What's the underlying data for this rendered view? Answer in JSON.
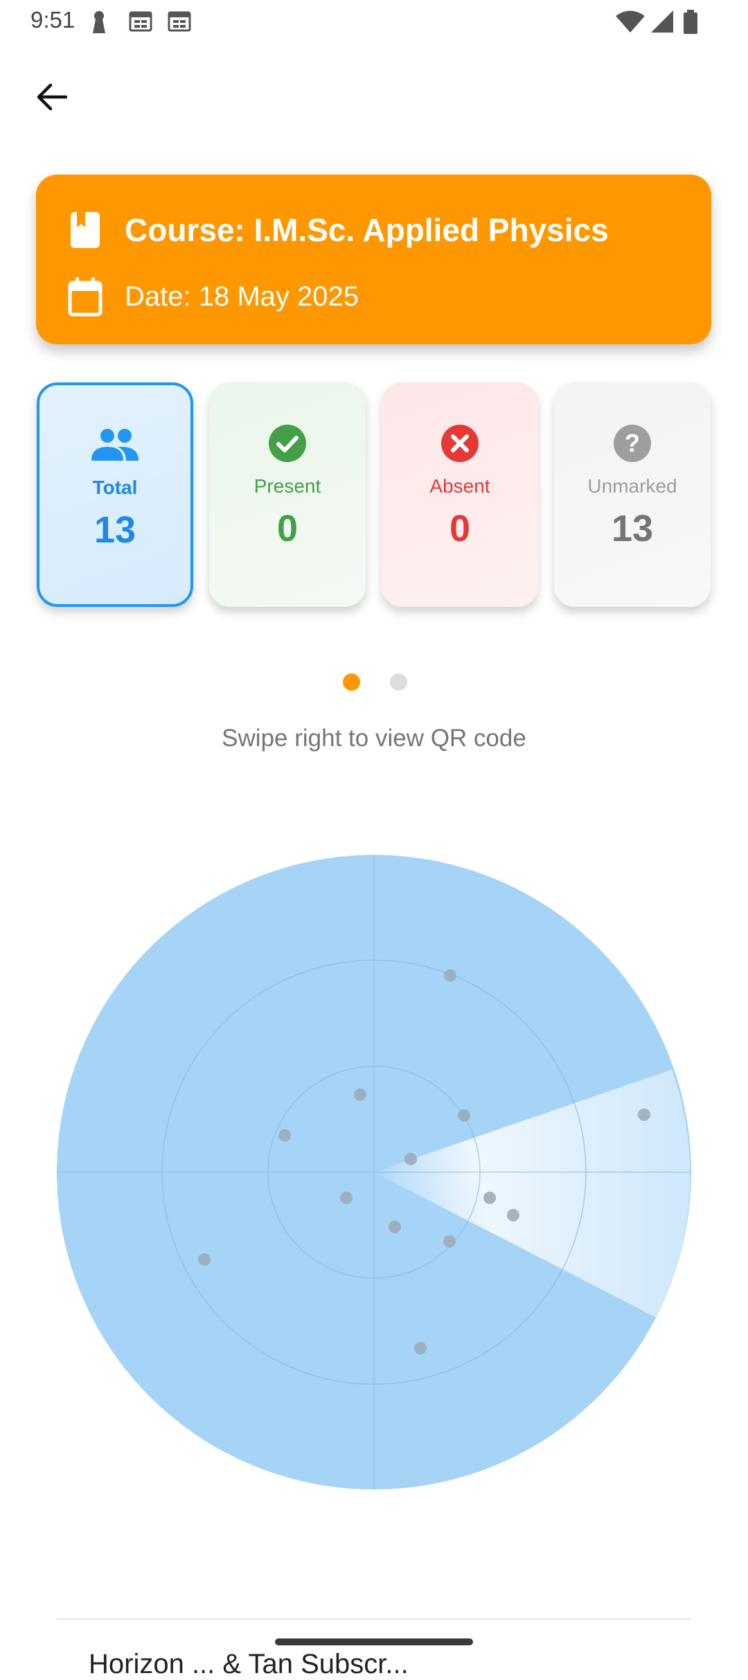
{
  "status_bar": {
    "time": "9:51",
    "icons_left": [
      "keyhole-icon",
      "calendar-notification-icon",
      "calendar-notification-icon"
    ],
    "icons_right": [
      "wifi-icon",
      "cellular-signal-icon",
      "battery-icon"
    ]
  },
  "app_bar": {
    "back_icon": "arrow-back-icon"
  },
  "course_card": {
    "accent_color": "#FF9800",
    "course_icon": "book-icon",
    "course_text": "Course: I.M.Sc. Applied Physics",
    "date_icon": "calendar-icon",
    "date_text": "Date: 18 May 2025"
  },
  "stats": [
    {
      "key": "total",
      "icon": "people-icon",
      "label": "Total",
      "value": "13",
      "color": "#2196F3",
      "selected": true
    },
    {
      "key": "present",
      "icon": "check-circle-icon",
      "label": "Present",
      "value": "0",
      "color": "#43A047"
    },
    {
      "key": "absent",
      "icon": "cancel-circle-icon",
      "label": "Absent",
      "value": "0",
      "color": "#E53935"
    },
    {
      "key": "unmarked",
      "icon": "help-circle-icon",
      "label": "Unmarked",
      "value": "13",
      "color": "#9E9E9E"
    }
  ],
  "pager": {
    "pages": 2,
    "active_page": 1,
    "active_color": "#FF9800",
    "inactive_color": "#DDDDDD"
  },
  "swipe_hint": "Swipe right to view QR code",
  "radar": {
    "fill_color": "#A6D4F7",
    "detected_dot_count": 13
  },
  "bottom": {
    "partial_text": "Horizon ... & Tan Subscr..."
  }
}
